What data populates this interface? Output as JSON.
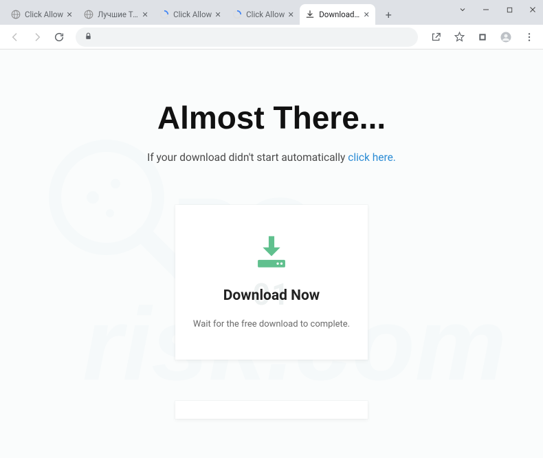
{
  "window": {
    "tabs": [
      {
        "title": "Click Allow",
        "favicon": "globe"
      },
      {
        "title": "Лучшие Tele",
        "favicon": "globe"
      },
      {
        "title": "Click Allow",
        "favicon": "spinner"
      },
      {
        "title": "Click Allow",
        "favicon": "spinner"
      },
      {
        "title": "Download Re",
        "favicon": "download",
        "active": true
      }
    ],
    "controls": {
      "dropdown": "⌄",
      "minimize": "—",
      "maximize": "☐",
      "close": "✕"
    }
  },
  "toolbar": {
    "back": "←",
    "forward": "→",
    "reload": "⟳",
    "share_tooltip": "Share",
    "bookmark_tooltip": "Bookmark",
    "extensions_tooltip": "Extensions",
    "profile_tooltip": "Profile",
    "menu_tooltip": "Menu"
  },
  "page": {
    "headline": "Almost There...",
    "subline_prefix": "If your download didn't start automatically ",
    "subline_link": "click here.",
    "card": {
      "bg_number": "01",
      "title": "Download Now",
      "body": "Wait for the free download to complete."
    },
    "watermark_text": "PCrisk.com"
  },
  "colors": {
    "accent_link": "#2a8bd4",
    "download_icon": "#60c08e",
    "titlebar": "#dee1e6"
  }
}
